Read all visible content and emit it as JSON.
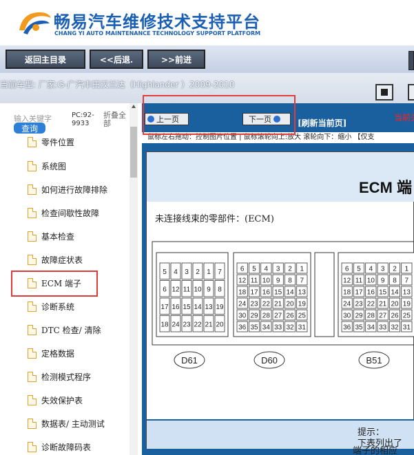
{
  "header": {
    "title_cn": "畅易汽车维修技术支持平台",
    "title_en": "CHANG YI AUTO MAINTENANCE TECHNOLOGY SUPPORT PLATFORM"
  },
  "nav": {
    "home_label": "返回主目录",
    "back_label": "<<后退.",
    "forward_label": ">>前进"
  },
  "model": {
    "text": "当前车型:   厂家:G-广汽丰田汉兰达（Highlander ）2009-2010"
  },
  "sidebar": {
    "search_placeholder": "输入关键字",
    "search_button": "查询",
    "pc_label": "PC:92-9933",
    "fold_label": "折叠全部",
    "items": [
      {
        "label": "零件位置"
      },
      {
        "label": "系统图"
      },
      {
        "label": "如何进行故障排除"
      },
      {
        "label": "检查间歇性故障"
      },
      {
        "label": "基本检查"
      },
      {
        "label": "故障症状表"
      },
      {
        "label": "ECM 端子"
      },
      {
        "label": "诊断系统"
      },
      {
        "label": "DTC 检查/ 清除"
      },
      {
        "label": "定格数据"
      },
      {
        "label": "检测模式程序"
      },
      {
        "label": "失效保护表"
      },
      {
        "label": "数据表/ 主动测试"
      },
      {
        "label": "诊断故障码表"
      }
    ]
  },
  "viewer": {
    "prev_label": "上一页",
    "next_label": "下一页",
    "refresh_label": "[刷新当前页]",
    "current_label": "当前关",
    "hint": "鼠标左右拖动：控制图片位置 | 鼠标滚轮向上:放大  滚轮向下：缩小 【仅支"
  },
  "document": {
    "title": "ECM 端",
    "section": "未连接线束的零部件：(ECM)",
    "connectors": [
      {
        "label": "D61",
        "pins": [
          "5",
          "4",
          "3",
          "2",
          "1",
          "7",
          "6",
          "12",
          "11",
          "10",
          "9",
          "8",
          "17",
          "16",
          "15",
          "14",
          "13",
          "19",
          "18",
          "24",
          "23",
          "22",
          "21",
          "20"
        ]
      },
      {
        "label": "D60",
        "pins": [
          "6",
          "5",
          "4",
          "3",
          "2",
          "1",
          "12",
          "11",
          "10",
          "9",
          "8",
          "7",
          "18",
          "17",
          "16",
          "15",
          "14",
          "13",
          "24",
          "23",
          "22",
          "21",
          "20",
          "19",
          "30",
          "29",
          "28",
          "27",
          "26",
          "25",
          "36",
          "35",
          "34",
          "33",
          "32",
          "31"
        ]
      },
      {
        "label": "B51",
        "pins": [
          "6",
          "5",
          "4",
          "3",
          "2",
          "1",
          "12",
          "11",
          "10",
          "9",
          "8",
          "7",
          "18",
          "17",
          "16",
          "15",
          "14",
          "13",
          "24",
          "23",
          "22",
          "21",
          "20",
          "19",
          "30",
          "29",
          "28",
          "27",
          "26",
          "25",
          "36",
          "35",
          "34",
          "33",
          "32",
          "31"
        ]
      }
    ],
    "tip_title": "提示：",
    "tip_line1": "下表列出了",
    "tip_line2": "端子的相应"
  },
  "colors": {
    "brand_blue": "#1a5fb4",
    "toolbar_blue": "#1a5f9e",
    "highlight_red": "#e03b3b"
  }
}
